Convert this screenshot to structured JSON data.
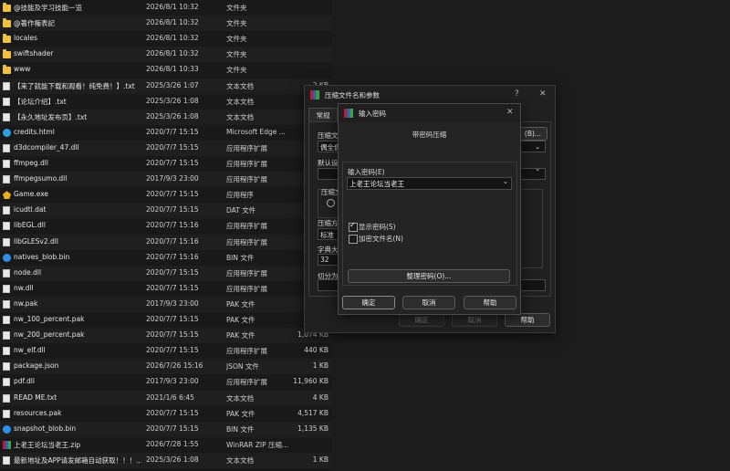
{
  "files": [
    {
      "name": "@技能及学习技能一览",
      "date": "2026/8/1 10:32",
      "type": "文件夹",
      "size": "",
      "icon": "folder"
    },
    {
      "name": "@著作権表記",
      "date": "2026/8/1 10:32",
      "type": "文件夹",
      "size": "",
      "icon": "folder"
    },
    {
      "name": "locales",
      "date": "2026/8/1 10:32",
      "type": "文件夹",
      "size": "",
      "icon": "folder"
    },
    {
      "name": "swiftshader",
      "date": "2026/8/1 10:32",
      "type": "文件夹",
      "size": "",
      "icon": "folder"
    },
    {
      "name": "www",
      "date": "2026/8/1 10:33",
      "type": "文件夹",
      "size": "",
      "icon": "folder"
    },
    {
      "name": "【来了就能下载和观看！纯免费！】.txt",
      "date": "2025/3/26 1:07",
      "type": "文本文档",
      "size": "2 KB",
      "icon": "file"
    },
    {
      "name": "【论坛介绍】.txt",
      "date": "2025/3/26 1:08",
      "type": "文本文档",
      "size": "",
      "icon": "file"
    },
    {
      "name": "【永久地址发布页】.txt",
      "date": "2025/3/26 1:08",
      "type": "文本文档",
      "size": "",
      "icon": "file"
    },
    {
      "name": "credits.html",
      "date": "2020/7/7 15:15",
      "type": "Microsoft Edge ...",
      "size": "",
      "icon": "edge"
    },
    {
      "name": "d3dcompiler_47.dll",
      "date": "2020/7/7 15:15",
      "type": "应用程序扩展",
      "size": "",
      "icon": "file"
    },
    {
      "name": "ffmpeg.dll",
      "date": "2020/7/7 15:15",
      "type": "应用程序扩展",
      "size": "",
      "icon": "file"
    },
    {
      "name": "ffmpegsumo.dll",
      "date": "2017/9/3 23:00",
      "type": "应用程序扩展",
      "size": "",
      "icon": "file"
    },
    {
      "name": "Game.exe",
      "date": "2020/7/7 15:15",
      "type": "应用程序",
      "size": "",
      "icon": "game"
    },
    {
      "name": "icudtl.dat",
      "date": "2020/7/7 15:15",
      "type": "DAT 文件",
      "size": "",
      "icon": "file"
    },
    {
      "name": "libEGL.dll",
      "date": "2020/7/7 15:16",
      "type": "应用程序扩展",
      "size": "",
      "icon": "file"
    },
    {
      "name": "libGLESv2.dll",
      "date": "2020/7/7 15:16",
      "type": "应用程序扩展",
      "size": "",
      "icon": "file"
    },
    {
      "name": "natives_blob.bin",
      "date": "2020/7/7 15:16",
      "type": "BIN 文件",
      "size": "",
      "icon": "blob"
    },
    {
      "name": "node.dll",
      "date": "2020/7/7 15:15",
      "type": "应用程序扩展",
      "size": "",
      "icon": "file"
    },
    {
      "name": "nw.dll",
      "date": "2020/7/7 15:15",
      "type": "应用程序扩展",
      "size": "",
      "icon": "file"
    },
    {
      "name": "nw.pak",
      "date": "2017/9/3 23:00",
      "type": "PAK 文件",
      "size": "",
      "icon": "file"
    },
    {
      "name": "nw_100_percent.pak",
      "date": "2020/7/7 15:15",
      "type": "PAK 文件",
      "size": "",
      "icon": "file"
    },
    {
      "name": "nw_200_percent.pak",
      "date": "2020/7/7 15:15",
      "type": "PAK 文件",
      "size": "1,074 KB",
      "icon": "file"
    },
    {
      "name": "nw_elf.dll",
      "date": "2020/7/7 15:15",
      "type": "应用程序扩展",
      "size": "440 KB",
      "icon": "file"
    },
    {
      "name": "package.json",
      "date": "2026/7/26 15:16",
      "type": "JSON 文件",
      "size": "1 KB",
      "icon": "file"
    },
    {
      "name": "pdf.dll",
      "date": "2017/9/3 23:00",
      "type": "应用程序扩展",
      "size": "11,960 KB",
      "icon": "file"
    },
    {
      "name": "READ ME.txt",
      "date": "2021/1/6 6:45",
      "type": "文本文档",
      "size": "4 KB",
      "icon": "file"
    },
    {
      "name": "resources.pak",
      "date": "2020/7/7 15:15",
      "type": "PAK 文件",
      "size": "4,517 KB",
      "icon": "file"
    },
    {
      "name": "snapshot_blob.bin",
      "date": "2020/7/7 15:15",
      "type": "BIN 文件",
      "size": "1,135 KB",
      "icon": "blob"
    },
    {
      "name": "上老王论坛当老王.zip",
      "date": "2026/7/28 1:55",
      "type": "WinRAR ZIP 压缩...",
      "size": "",
      "icon": "zip"
    },
    {
      "name": "最新地址及APP请发邮箱自动获取！！！...",
      "date": "2025/3/26 1:08",
      "type": "文本文档",
      "size": "1 KB",
      "icon": "file"
    }
  ],
  "archive_dialog": {
    "title": "压缩文件名和参数",
    "help_glyph": "?",
    "close_glyph": "✕",
    "tab_general": "常规",
    "label_archive_name": "压缩文",
    "field_name_value": "偶全偶",
    "label_default": "默认设",
    "label_format": "压缩文",
    "label_method": "压缩方",
    "field_method_value": "标准",
    "label_dict": "字典大",
    "field_dict_value": "32",
    "label_split": "切分为",
    "browse_label": "(B)...",
    "ok_label": "确定",
    "cancel_label": "取消",
    "help_label": "帮助"
  },
  "password_dialog": {
    "title": "输入密码",
    "close_glyph": "✕",
    "heading": "带密码压缩",
    "input_label": "输入密码(E)",
    "password_value": "上老王论坛当老王",
    "show_password_label": "显示密码(S)",
    "show_password_checked": true,
    "encrypt_names_label": "加密文件名(N)",
    "encrypt_names_checked": false,
    "organize_label": "整理密码(O)...",
    "ok_label": "确定",
    "cancel_label": "取消",
    "help_label": "帮助"
  }
}
